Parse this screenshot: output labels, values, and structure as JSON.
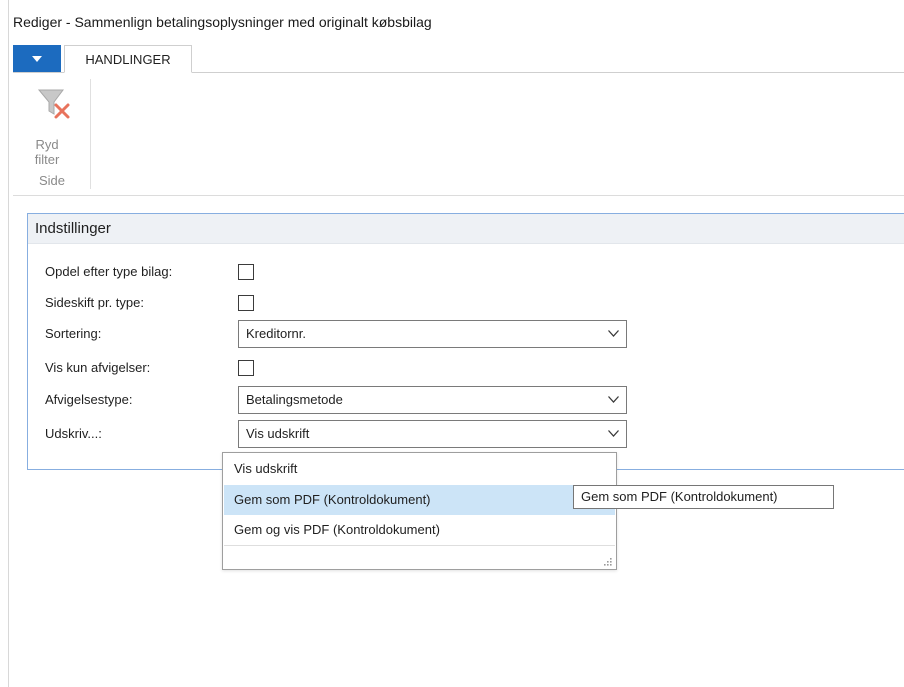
{
  "window": {
    "title": "Rediger - Sammenlign betalingsoplysninger med originalt købsbilag"
  },
  "ribbon": {
    "tab_label": "HANDLINGER",
    "menu_icon": "caret-down-icon",
    "group_label": "Side",
    "clear_filter": {
      "line1": "Ryd",
      "line2": "filter",
      "icon": "clear-filter-icon"
    }
  },
  "panel": {
    "header": "Indstillinger",
    "fields": {
      "split_label": "Opdel efter type bilag:",
      "split_checked": false,
      "pagebreak_label": "Sideskift pr. type:",
      "pagebreak_checked": false,
      "sort_label": "Sortering:",
      "sort_value": "Kreditornr.",
      "deviations_label": "Vis kun afvigelser:",
      "deviations_checked": false,
      "devtype_label": "Afvigelsestype:",
      "devtype_value": "Betalingsmetode",
      "print_label": "Udskriv...:",
      "print_value": "Vis udskrift"
    }
  },
  "dropdown": {
    "options": [
      "Vis udskrift",
      "Gem som PDF (Kontroldokument)",
      "Gem og vis PDF (Kontroldokument)"
    ],
    "highlighted_index": 1,
    "highlight_color": "#cce4f7"
  },
  "tooltip": {
    "text": "Gem som PDF (Kontroldokument)"
  },
  "colors": {
    "accent": "#1c6bbf",
    "panel_border": "#87aee0"
  }
}
